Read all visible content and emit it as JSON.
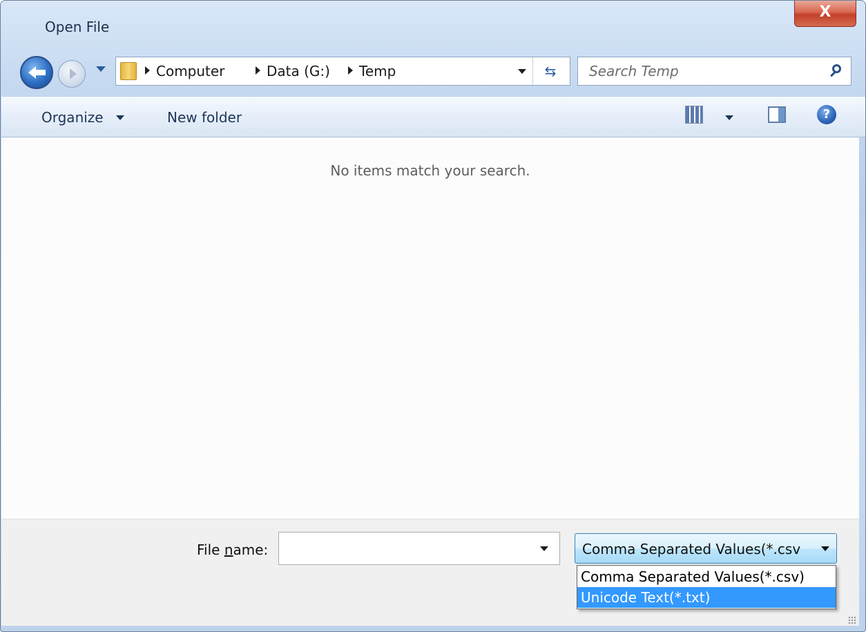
{
  "window": {
    "title": "Open File",
    "close_label": "X"
  },
  "navigation": {
    "breadcrumbs": [
      "Computer",
      "Data (G:)",
      "Temp"
    ],
    "search_placeholder": "Search Temp"
  },
  "toolbar": {
    "organize_label": "Organize",
    "new_folder_label": "New folder",
    "help_label": "?"
  },
  "content": {
    "empty_message": "No items match your search."
  },
  "bottom": {
    "file_name_label": "File name:",
    "file_name_value": "",
    "file_type_selected": "Comma Separated Values(*.csv",
    "file_type_options": [
      "Comma Separated Values(*.csv)",
      "Unicode Text(*.txt)"
    ],
    "highlighted_option": "Unicode Text(*.txt)"
  },
  "colors": {
    "highlight": "#3399ff",
    "close_button": "#c2402a",
    "frame": "#c5d9f1"
  }
}
